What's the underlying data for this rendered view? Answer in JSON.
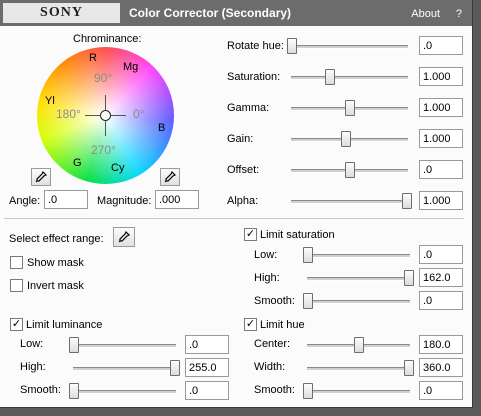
{
  "header": {
    "logo": "SONY",
    "title": "Color Corrector (Secondary)",
    "about": "About",
    "help": "?"
  },
  "wheel": {
    "label": "Chrominance:",
    "markers": {
      "r": "R",
      "mg": "Mg",
      "yl": "Yl",
      "b": "B",
      "g": "G",
      "cy": "Cy"
    },
    "degrees": {
      "d90": "90°",
      "d180": "180°",
      "d0": "0°",
      "d270": "270°"
    },
    "angle_label": "Angle:",
    "angle_value": ".0",
    "magnitude_label": "Magnitude:",
    "magnitude_value": ".000"
  },
  "sliders": [
    {
      "label": "Rotate hue:",
      "value": ".0",
      "level": 0.0
    },
    {
      "label": "Saturation:",
      "value": "1.000",
      "level": 0.33
    },
    {
      "label": "Gamma:",
      "value": "1.000",
      "level": 0.5
    },
    {
      "label": "Gain:",
      "value": "1.000",
      "level": 0.47
    },
    {
      "label": "Offset:",
      "value": ".0",
      "level": 0.5
    },
    {
      "label": "Alpha:",
      "value": "1.000",
      "level": 1.0
    }
  ],
  "range": {
    "select_label": "Select effect range:",
    "show_mask": "Show mask",
    "show_mask_checked": false,
    "invert_mask": "Invert mask",
    "invert_mask_checked": false
  },
  "limit_saturation": {
    "label": "Limit saturation",
    "checked": true,
    "low_label": "Low:",
    "low_value": ".0",
    "low_level": 0.0,
    "high_label": "High:",
    "high_value": "162.0",
    "high_level": 1.0,
    "smooth_label": "Smooth:",
    "smooth_value": ".0",
    "smooth_level": 0.0
  },
  "limit_luminance": {
    "label": "Limit luminance",
    "checked": true,
    "low_label": "Low:",
    "low_value": ".0",
    "low_level": 0.0,
    "high_label": "High:",
    "high_value": "255.0",
    "high_level": 1.0,
    "smooth_label": "Smooth:",
    "smooth_value": ".0",
    "smooth_level": 0.0
  },
  "limit_hue": {
    "label": "Limit hue",
    "checked": true,
    "center_label": "Center:",
    "center_value": "180.0",
    "center_level": 0.5,
    "width_label": "Width:",
    "width_value": "360.0",
    "width_level": 1.0,
    "smooth_label": "Smooth:",
    "smooth_value": ".0",
    "smooth_level": 0.0
  },
  "icons": {
    "eyedropper": "eyedropper-icon",
    "check": "✓"
  }
}
